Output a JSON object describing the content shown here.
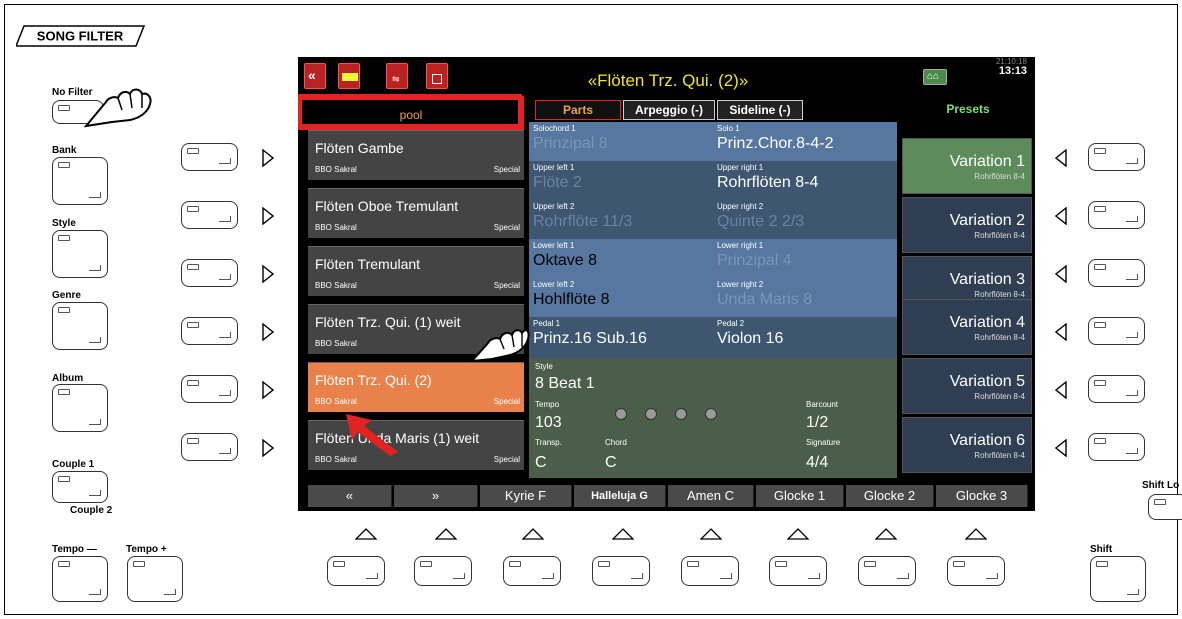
{
  "panel": {
    "song_filter": "SONG FILTER",
    "left_labels": {
      "no_filter": "No Filter",
      "bank": "Bank",
      "style": "Style",
      "genre": "Genre",
      "album": "Album",
      "couple1": "Couple 1",
      "couple2": "Couple 2",
      "tempo_minus": "Tempo —",
      "tempo_plus": "Tempo +"
    },
    "right_labels": {
      "shift_lock": "Shift Lo",
      "shift": "Shift"
    }
  },
  "screen": {
    "title": "«Flöten Trz. Qui. (2)»",
    "clock": "13:13",
    "clock_dim": "21:10:18",
    "icons": [
      "back-icon",
      "menu-icon",
      "usb-icon",
      "trash-icon",
      "shift-icon"
    ],
    "pool_label": "pool",
    "tabs": [
      "Parts",
      "Arpeggio (-)",
      "Sideline (-)"
    ],
    "presets_label": "Presets",
    "list": [
      {
        "name": "Flöten Gambe",
        "sub": "BBO Sakral",
        "special": "Special"
      },
      {
        "name": "Flöten Oboe Tremulant",
        "sub": "BBO Sakral",
        "special": "Special"
      },
      {
        "name": "Flöten Tremulant",
        "sub": "BBO Sakral",
        "special": "Special"
      },
      {
        "name": "Flöten Trz. Qui. (1) weit",
        "sub": "BBO Sakral",
        "special": ""
      },
      {
        "name": "Flöten Trz. Qui. (2)",
        "sub": "BBO Sakral",
        "special": "Special"
      },
      {
        "name": "Flöten Unda Maris (1) weit",
        "sub": "BBO Sakral",
        "special": "Special"
      }
    ],
    "parts": [
      {
        "label": "Solochord 1",
        "value": "Prinzipal     8",
        "active": false
      },
      {
        "label": "Solo 1",
        "value": "Prinz.Chor.8-4-2",
        "active": true
      },
      {
        "label": "Upper left 1",
        "value": "Flöte       2",
        "active": false
      },
      {
        "label": "Upper right 1",
        "value": "Rohrflöten  8-4",
        "active": true
      },
      {
        "label": "Upper left 2",
        "value": "Rohrflöte 11/3",
        "active": false
      },
      {
        "label": "Upper right 2",
        "value": "Quinte    2 2/3",
        "active": false
      },
      {
        "label": "Lower left 1",
        "value": "Oktave       8",
        "active": true
      },
      {
        "label": "Lower right 1",
        "value": "Prinzipal     4",
        "active": false
      },
      {
        "label": "Lower left 2",
        "value": "Hohlflöte    8",
        "active": true
      },
      {
        "label": "Lower right 2",
        "value": "Unda Maris   8",
        "active": false
      },
      {
        "label": "Pedal 1",
        "value": "Prinz.16  Sub.16",
        "active": true
      },
      {
        "label": "Pedal 2",
        "value": "Violon       16",
        "active": true
      }
    ],
    "style": {
      "style_label": "Style",
      "style_value": "8 Beat 1",
      "tempo_label": "Tempo",
      "tempo_value": "103",
      "barcount_label": "Barcount",
      "barcount_value": "1/2",
      "transp_label": "Transp.",
      "transp_value": "C",
      "chord_label": "Chord",
      "chord_value": "C",
      "signature_label": "Signature",
      "signature_value": "4/4"
    },
    "variations": [
      {
        "name": "Variation 1",
        "sub": "Rohrflöten  8-4",
        "active": true
      },
      {
        "name": "Variation 2",
        "sub": "Rohrflöten  8-4",
        "active": false
      },
      {
        "name": "Variation 3",
        "sub": "Rohrflöten  8-4",
        "active": false
      },
      {
        "name": "Variation 4",
        "sub": "Rohrflöten  8-4",
        "active": false
      },
      {
        "name": "Variation 5",
        "sub": "Rohrflöten  8-4",
        "active": false
      },
      {
        "name": "Variation 6",
        "sub": "Rohrflöten  8-4",
        "active": false
      }
    ],
    "bottom": [
      "«",
      "»",
      "Kyrie F",
      "Halleluja G",
      "Amen   C",
      "Glocke 1",
      "Glocke 2",
      "Glocke 3"
    ]
  },
  "colors": {
    "title": "#f3e230",
    "selected_item": "#e8814a",
    "highlight_box": "#e32222",
    "presets": "#7ce07c",
    "active_variation": "#5b8c5a"
  }
}
